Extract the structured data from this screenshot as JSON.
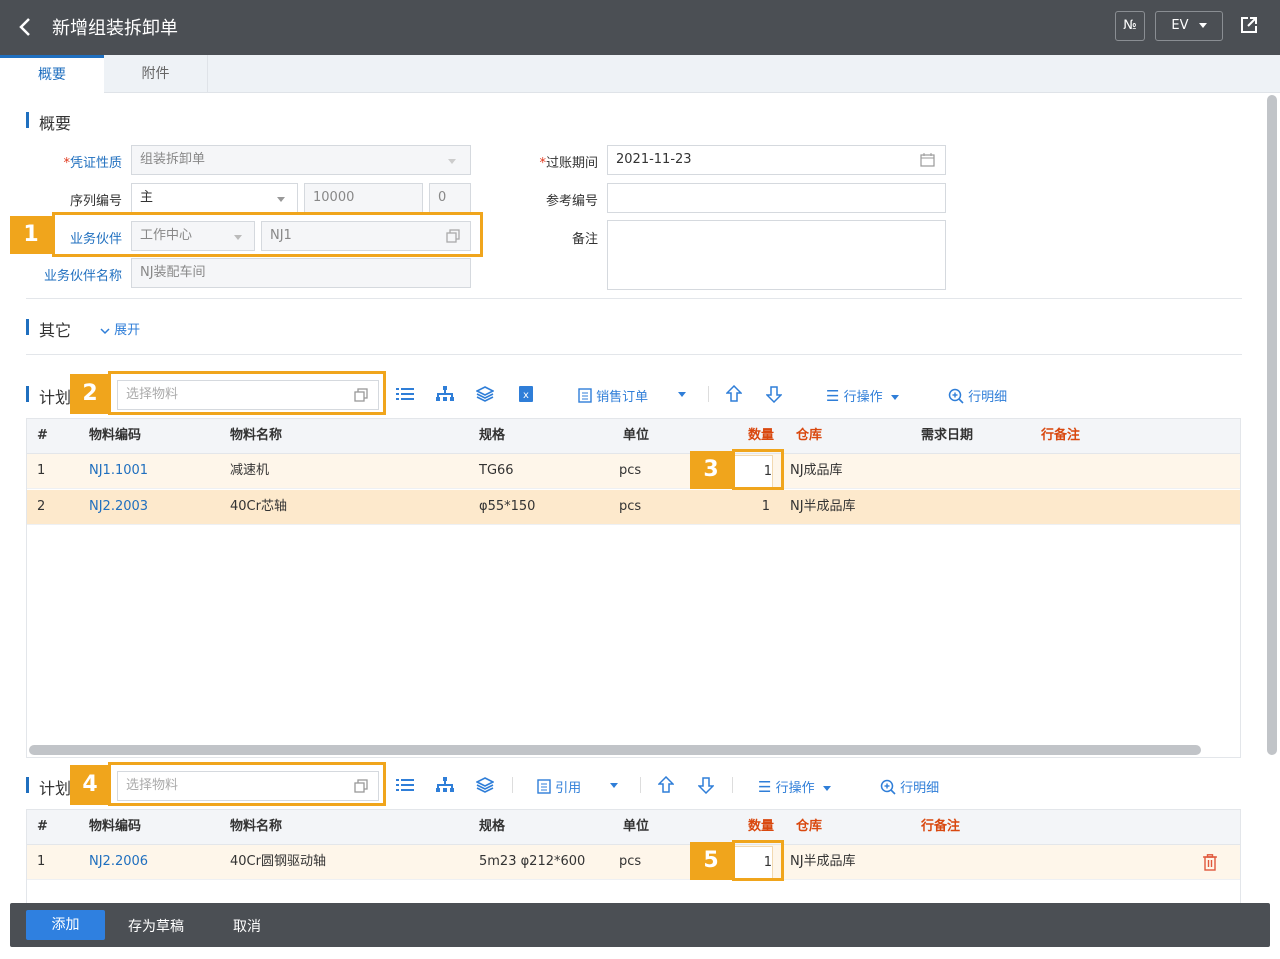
{
  "header": {
    "title": "新增组装拆卸单",
    "btn_no": "№",
    "btn_ev": "EV"
  },
  "tabs": [
    {
      "label": "概要"
    },
    {
      "label": "附件"
    }
  ],
  "summary": {
    "section_title": "概要",
    "voucher_type_label": "凭证性质",
    "voucher_type_value": "组装拆卸单",
    "serial_label": "序列编号",
    "serial_value": "主",
    "serial_no": "10000",
    "serial_suffix": "0",
    "partner_label": "业务伙伴",
    "partner_type": "工作中心",
    "partner_code": "NJ1",
    "partner_name_label": "业务伙伴名称",
    "partner_name_value": "NJ装配车间",
    "posting_date_label": "过账期间",
    "posting_date_value": "2021-11-23",
    "ref_no_label": "参考编号",
    "ref_no_value": "",
    "remark_label": "备注",
    "remark_value": ""
  },
  "other": {
    "section_title": "其它",
    "expand_label": "展开"
  },
  "plan1": {
    "section_title": "计划",
    "material_placeholder": "选择物料",
    "sales_order_label": "销售订单",
    "row_op_label": "行操作",
    "row_detail_label": "行明细",
    "columns": [
      "#",
      "物料编码",
      "物料名称",
      "规格",
      "单位",
      "数量",
      "仓库",
      "需求日期",
      "行备注"
    ],
    "rows": [
      {
        "no": "1",
        "code": "NJ1.1001",
        "name": "减速机",
        "spec": "TG66",
        "unit": "pcs",
        "qty": "1",
        "warehouse": "NJ成品库",
        "date": "",
        "note": ""
      },
      {
        "no": "2",
        "code": "NJ2.2003",
        "name": "40Cr芯轴",
        "spec": "φ55*150",
        "unit": "pcs",
        "qty": "1",
        "warehouse": "NJ半成品库",
        "date": "",
        "note": ""
      }
    ]
  },
  "plan2": {
    "section_title": "计划",
    "material_placeholder": "选择物料",
    "quote_label": "引用",
    "row_op_label": "行操作",
    "row_detail_label": "行明细",
    "columns": [
      "#",
      "物料编码",
      "物料名称",
      "规格",
      "单位",
      "数量",
      "仓库",
      "行备注"
    ],
    "rows": [
      {
        "no": "1",
        "code": "NJ2.2006",
        "name": "40Cr圆钢驱动轴",
        "spec": "5m23 φ212*600",
        "unit": "pcs",
        "qty": "1",
        "warehouse": "NJ半成品库",
        "note": ""
      }
    ]
  },
  "badges": [
    "1",
    "2",
    "3",
    "4",
    "5"
  ],
  "footer": {
    "add_label": "添加",
    "draft_label": "存为草稿",
    "cancel_label": "取消"
  },
  "colors": {
    "accent": "#1f6fbf",
    "highlight": "#f0a51c",
    "topbar": "#4b4f54"
  }
}
